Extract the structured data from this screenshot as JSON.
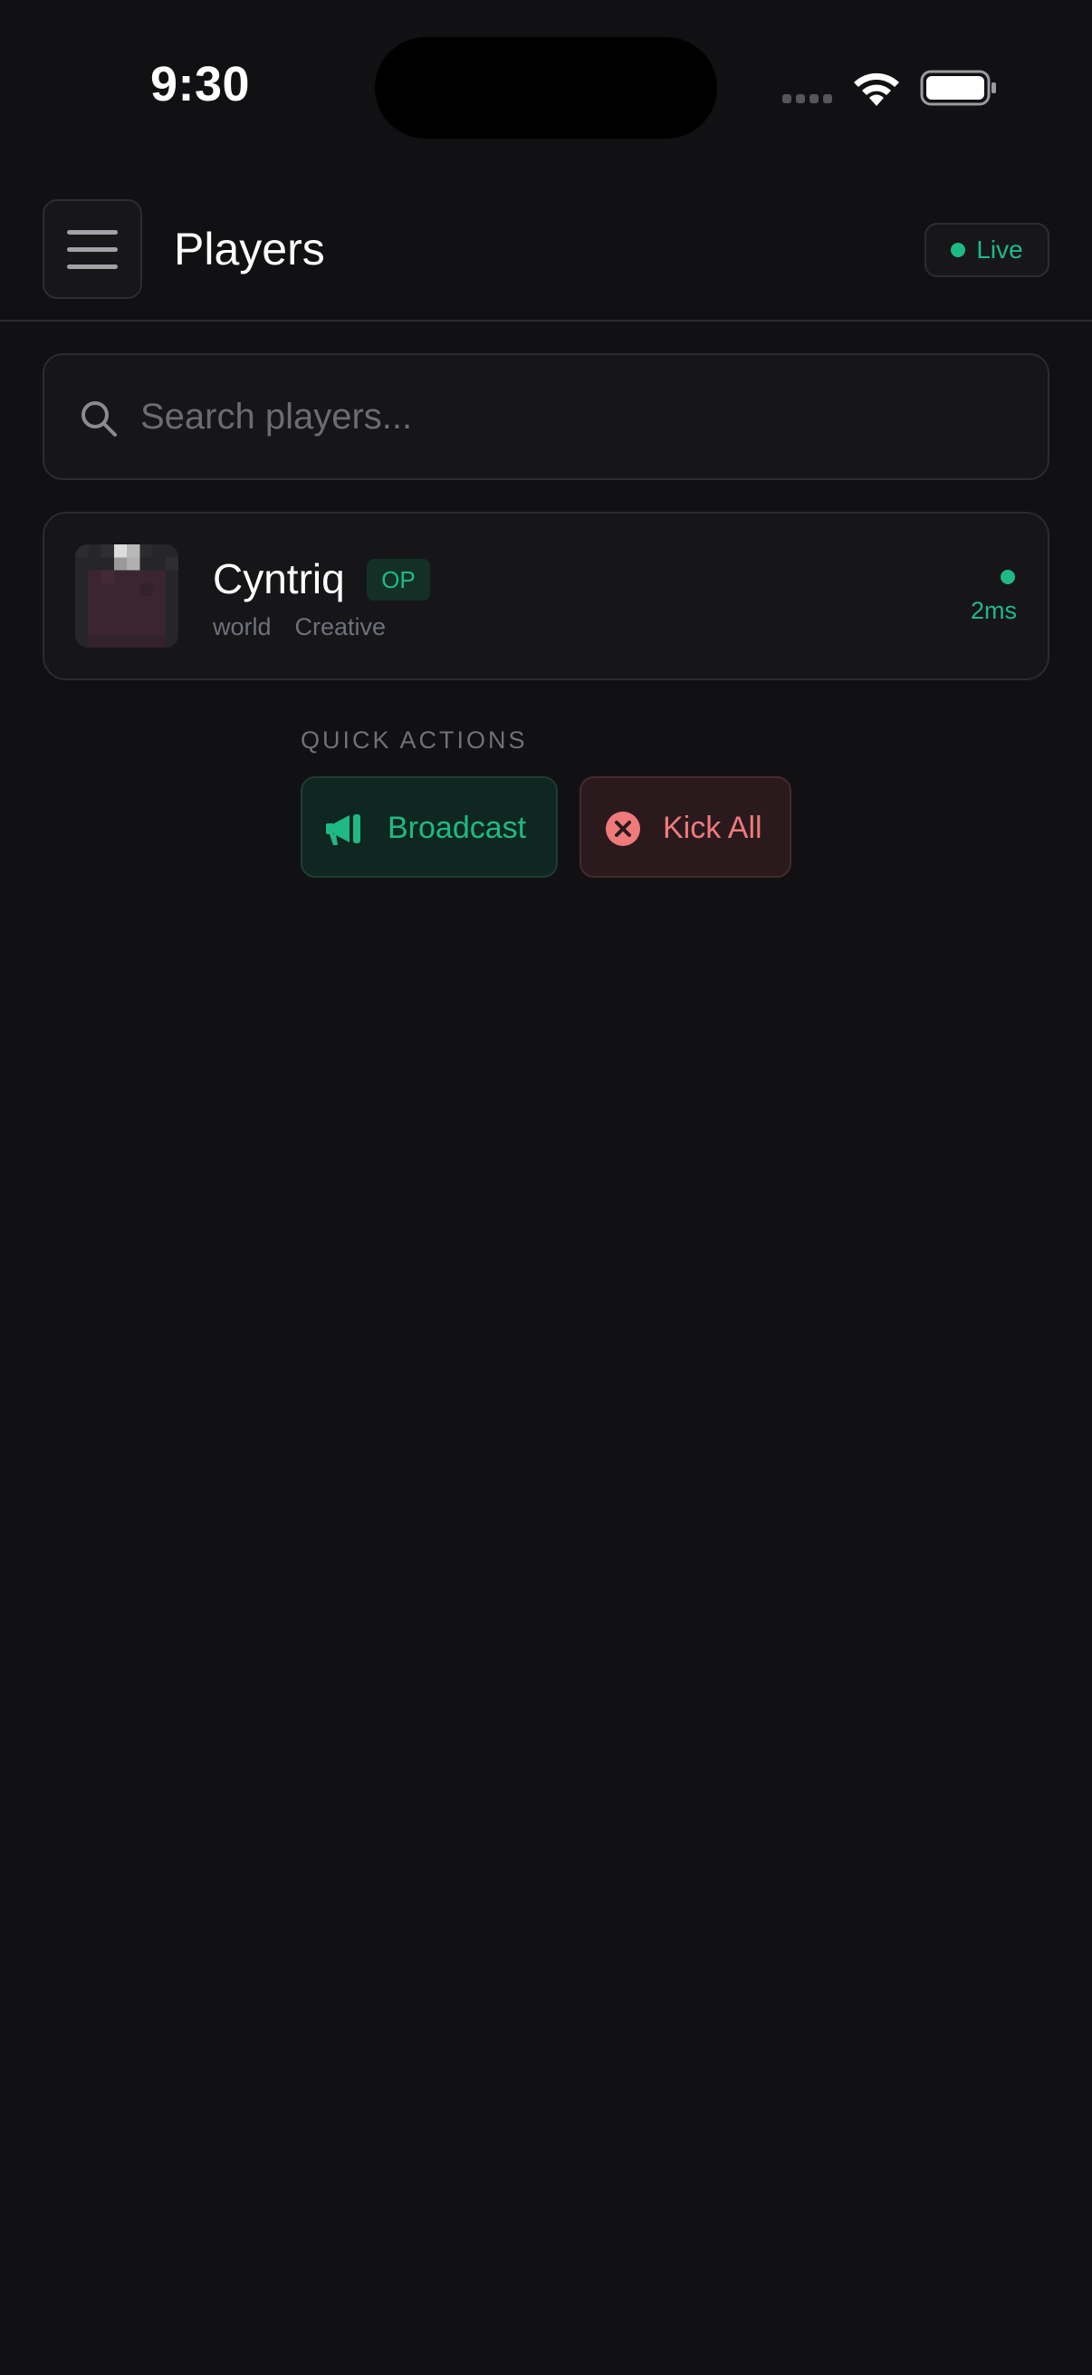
{
  "status_bar": {
    "time": "9:30"
  },
  "header": {
    "title": "Players",
    "live_label": "Live"
  },
  "search": {
    "placeholder": "Search players..."
  },
  "players": [
    {
      "name": "Cyntriq",
      "badge": "OP",
      "world": "world",
      "gamemode": "Creative",
      "ping": "2ms"
    }
  ],
  "quick_actions": {
    "title": "QUICK ACTIONS",
    "broadcast_label": "Broadcast",
    "kick_all_label": "Kick All"
  },
  "colors": {
    "accent_green": "#1fb985",
    "danger_red": "#f07a7a",
    "background": "#111113"
  },
  "icons": {
    "menu": "hamburger-icon",
    "search": "search-icon",
    "broadcast": "megaphone-icon",
    "kick_all": "close-circle-icon",
    "wifi": "wifi-icon",
    "battery": "battery-icon"
  }
}
